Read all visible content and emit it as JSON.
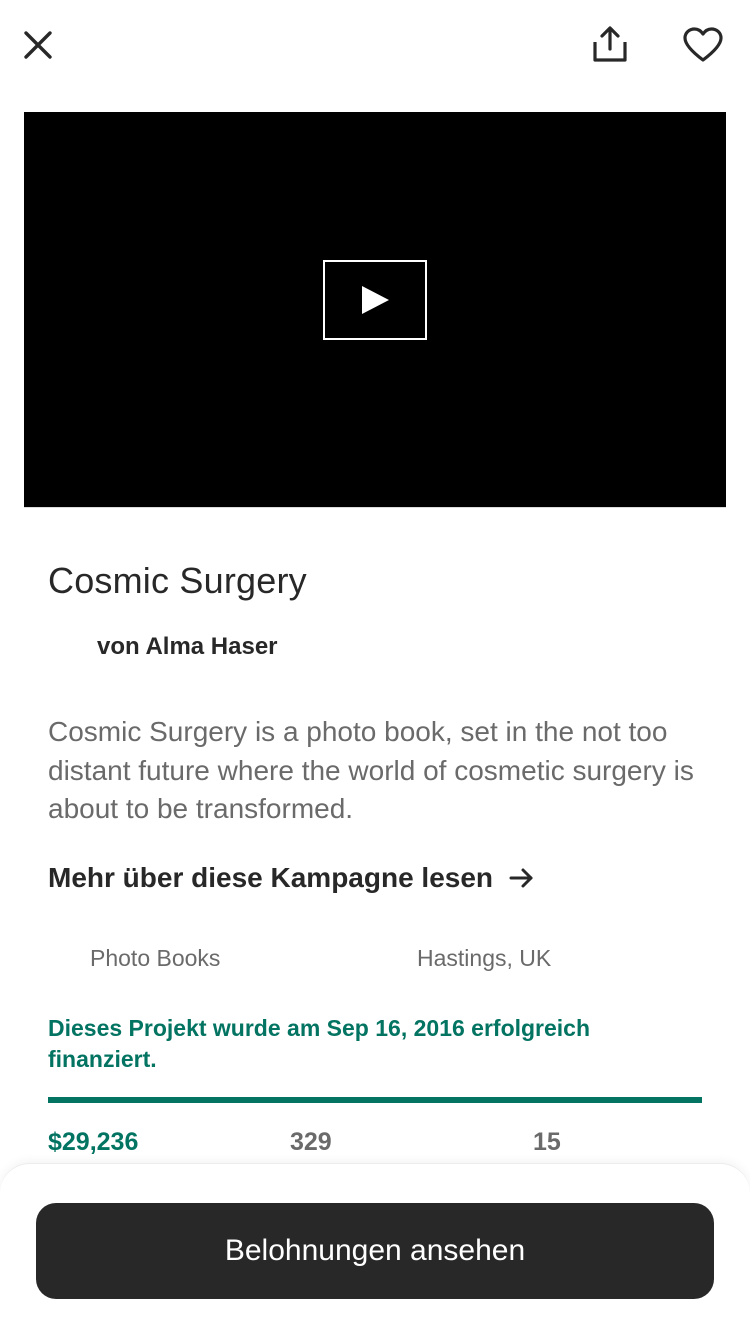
{
  "header": {
    "close_icon": "close-icon",
    "share_icon": "share-icon",
    "favorite_icon": "heart-icon"
  },
  "video": {
    "play_icon": "play-icon"
  },
  "project": {
    "title": "Cosmic Surgery",
    "author": "von Alma Haser",
    "description": "Cosmic Surgery is a photo book, set in the not too distant future where the world of cosmetic surgery is about to be transformed.",
    "more_link": "Mehr über diese Kampagne lesen",
    "category": "Photo Books",
    "location": "Hastings, UK",
    "funded_note": "Dieses Projekt wurde am Sep 16, 2016 erfolgreich finanziert.",
    "progress_percent": 100
  },
  "stats": {
    "pledged": "$29,236",
    "backers": "329",
    "days": "15"
  },
  "footer": {
    "cta_label": "Belohnungen ansehen"
  },
  "colors": {
    "accent_green": "#037362",
    "text_dark": "#282828",
    "text_muted": "#6a6a6a"
  }
}
